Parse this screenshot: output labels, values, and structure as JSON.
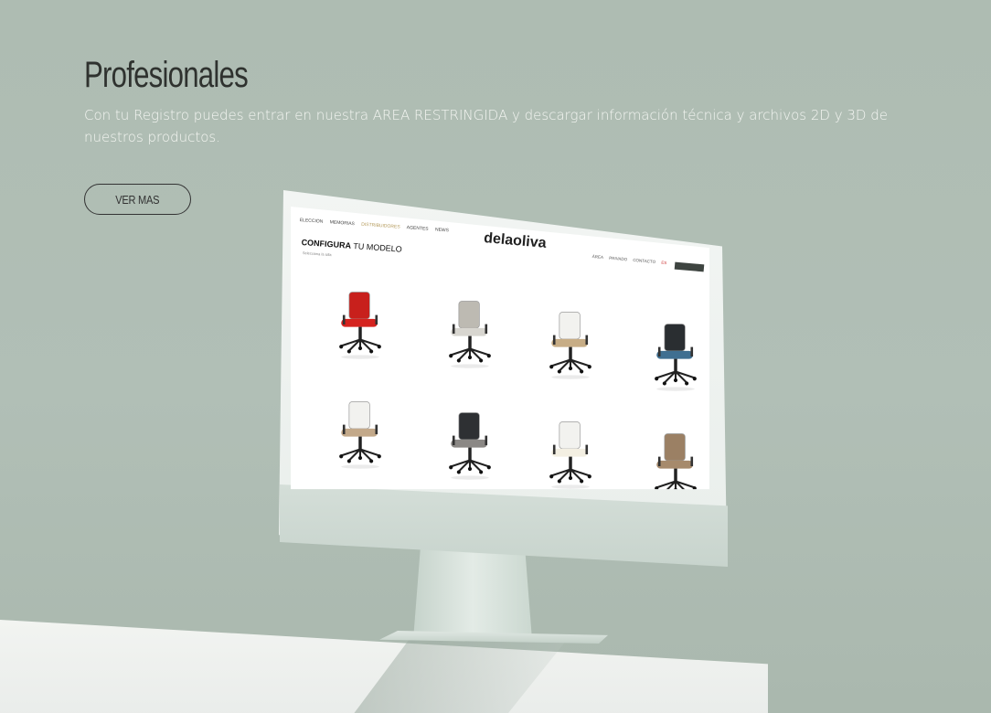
{
  "hero": {
    "title": "Profesionales",
    "text": "Con tu Registro puedes entrar en nuestra AREA RESTRINGIDA y descargar información técnica y archivos 2D y 3D de nuestros productos.",
    "button_label": "VER MAS"
  },
  "screen": {
    "nav_items": [
      "ELECCIÓN",
      "MEMORIAS",
      "DISTRIBUIDORES",
      "AGENTES",
      "NEWS"
    ],
    "logo": "delaoliva",
    "heading_bold": "CONFIGURA",
    "heading_rest": " TU MODELO",
    "subheading": "Selecciona la silla",
    "right_items": [
      "ÁREA",
      "PRIVADO",
      "CONTACTO",
      "ES"
    ],
    "chairs": [
      {
        "seat": "#d5231f",
        "back": "#c8201c"
      },
      {
        "seat": "#d8d6d0",
        "back": "#bdbab2"
      },
      {
        "seat": "#c7ad86",
        "back": "#f2f2ef"
      },
      {
        "seat": "#3f6f91",
        "back": "#2a2e31"
      },
      {
        "seat": "#c3a98a",
        "back": "#f2f2ef"
      },
      {
        "seat": "#8b8885",
        "back": "#2e3033"
      },
      {
        "seat": "#f3efe2",
        "back": "#f2f2ef"
      },
      {
        "seat": "#a68a6c",
        "back": "#9b8064"
      }
    ]
  }
}
